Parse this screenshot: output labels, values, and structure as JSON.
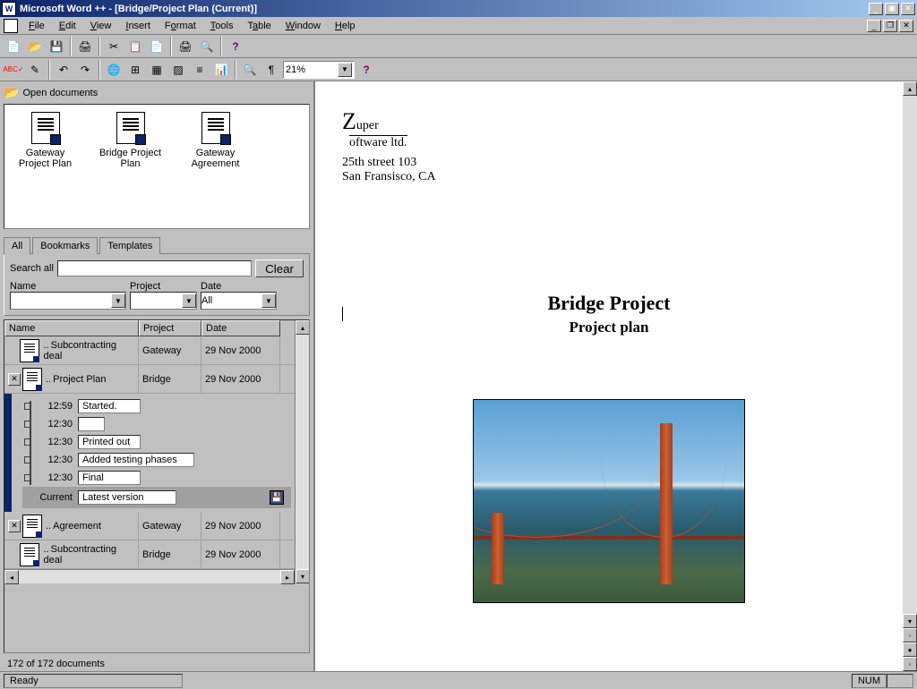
{
  "window": {
    "title": "Microsoft Word ++ - [Bridge/Project Plan (Current)]"
  },
  "menu": {
    "file": "File",
    "edit": "Edit",
    "view": "View",
    "insert": "Insert",
    "format": "Format",
    "tools": "Tools",
    "table": "Table",
    "window": "Window",
    "help": "Help"
  },
  "toolbar": {
    "zoom": "21%"
  },
  "open_docs": {
    "label": "Open documents",
    "items": [
      {
        "name": "Gateway Project Plan"
      },
      {
        "name": "Bridge Project Plan"
      },
      {
        "name": "Gateway Agreement"
      }
    ]
  },
  "tabs": {
    "all": "All",
    "bookmarks": "Bookmarks",
    "templates": "Templates"
  },
  "search": {
    "label": "Search all",
    "clear": "Clear",
    "name_label": "Name",
    "project_label": "Project",
    "date_label": "Date",
    "date_value": "All"
  },
  "list": {
    "col_name": "Name",
    "col_project": "Project",
    "col_date": "Date",
    "rows": [
      {
        "name": "Subcontracting deal",
        "project": "Gateway",
        "date": "29 Nov 2000"
      },
      {
        "name": "Project Plan",
        "project": "Bridge",
        "date": "29 Nov 2000"
      },
      {
        "name": "Agreement",
        "project": "Gateway",
        "date": "29 Nov 2000"
      },
      {
        "name": "Subcontracting deal",
        "project": "Bridge",
        "date": "29 Nov 2000"
      }
    ],
    "status": "172 of 172 documents"
  },
  "timeline": [
    {
      "time": "12:59",
      "label": "Started."
    },
    {
      "time": "12:30",
      "label": ""
    },
    {
      "time": "12:30",
      "label": "Printed out"
    },
    {
      "time": "12:30",
      "label": "Added testing phases"
    },
    {
      "time": "12:30",
      "label": "Final"
    }
  ],
  "timeline_current": {
    "time": "Current",
    "label": "Latest version"
  },
  "document": {
    "company1": "uper",
    "company2": "oftware ltd.",
    "addr1": "25th street 103",
    "addr2": "San Fransisco, CA",
    "title": "Bridge Project",
    "subtitle": "Project plan"
  },
  "statusbar": {
    "ready": "Ready",
    "num": "NUM"
  }
}
